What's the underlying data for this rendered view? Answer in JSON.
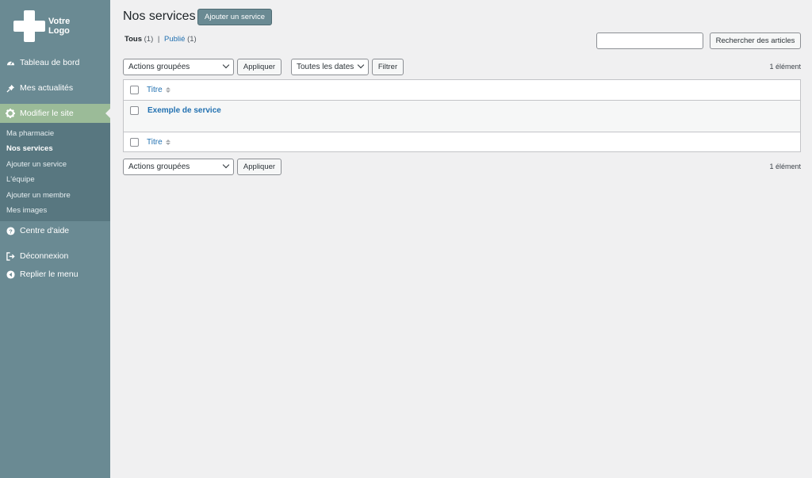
{
  "logo": {
    "line1": "Votre",
    "line2": "Logo"
  },
  "sidebar": {
    "items": [
      {
        "label": "Tableau de bord",
        "icon": "dashboard-icon"
      },
      {
        "label": "Mes actualités",
        "icon": "pin-icon"
      },
      {
        "label": "Modifier le site",
        "icon": "gear-icon"
      },
      {
        "label": "Centre d'aide",
        "icon": "help-icon"
      },
      {
        "label": "Déconnexion",
        "icon": "logout-icon"
      },
      {
        "label": "Replier le menu",
        "icon": "collapse-icon"
      }
    ],
    "submenu": [
      {
        "label": "Ma pharmacie"
      },
      {
        "label": "Nos services"
      },
      {
        "label": "Ajouter un service"
      },
      {
        "label": "L'équipe"
      },
      {
        "label": "Ajouter un membre"
      },
      {
        "label": "Mes images"
      }
    ]
  },
  "header": {
    "title": "Nos services",
    "add_label": "Ajouter un service"
  },
  "filters": {
    "all_label": "Tous",
    "all_count": "(1)",
    "sep": "|",
    "published_label": "Publié",
    "published_count": "(1)"
  },
  "search": {
    "button_label": "Rechercher des articles",
    "value": ""
  },
  "toolbar": {
    "bulk_label": "Actions groupées",
    "apply_label": "Appliquer",
    "dates_label": "Toutes les dates",
    "filter_label": "Filtrer",
    "count": "1 élément"
  },
  "table": {
    "column_title": "Titre",
    "rows": [
      {
        "title": "Exemple de service"
      }
    ]
  },
  "colors": {
    "sidebar": "#6a8a93",
    "submenu": "#587780",
    "active": "#9bbb98",
    "link": "#2271b1"
  }
}
